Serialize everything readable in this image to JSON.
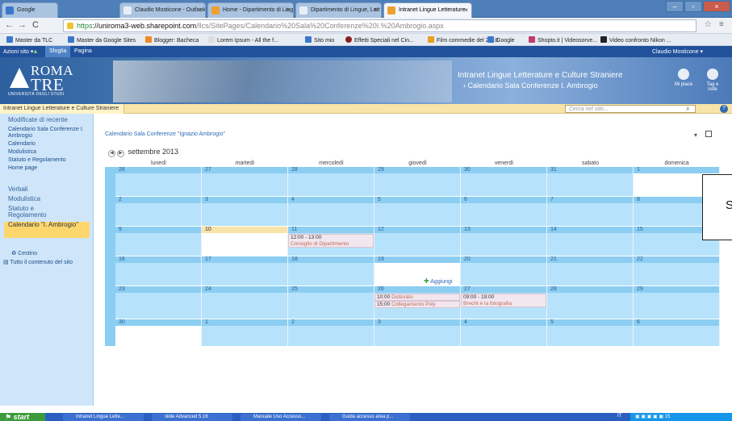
{
  "browser": {
    "tabs": [
      {
        "label": "Google"
      },
      {
        "label": "Claudio Mosticone - Outlook"
      },
      {
        "label": "Home - Dipartimento di Ling"
      },
      {
        "label": "Dipartimento di Lingue, Lett"
      },
      {
        "label": "Intranet Lingue Letterature"
      }
    ],
    "url_scheme": "https",
    "url_host": "://uniroma3-web.sharepoint.com",
    "url_path": "/llcs/SitePages/Calendario%20Sala%20Conferenze%20I.%20Ambrogio.aspx",
    "bookmarks": [
      "Master da TLC",
      "Master da Google Sites",
      "Blogger: Bacheca",
      "Lorem Ipsum - All the f...",
      "Sito mio",
      "Effetti Speciali nel Cin...",
      "Film commedie del 2010",
      "Google",
      "Shopto.it | Videosorve...",
      "Video confronto Nikon ..."
    ]
  },
  "ribbon": {
    "site_actions": "Azioni sito ▾",
    "browse_tab": "Sfoglia",
    "page_tab": "Pagina",
    "user": "Claudio Mosticone ▾"
  },
  "header": {
    "logo_line1": "ROMA",
    "logo_line2": "TRE",
    "logo_sub": "UNIVERSITÀ DEGLI STUDI",
    "site_title": "Intranet Lingue Letterature e Culture Straniere",
    "page_title": "› Calendario Sala Conferenze I. Ambrogio",
    "like_label": "Mi piace",
    "tags_label": "Tag e note"
  },
  "titlebar": {
    "breadcrumb": "Intranet Lingue Letterature e Culture Straniere",
    "search_placeholder": "Cerca nel sito..."
  },
  "leftnav": {
    "recent_header": "Modificate di recente",
    "recent_items": [
      "Calendario Sala Conferenze I. Ambrogio",
      "Calendario",
      "Modulistica",
      "Statuto e Regolamento",
      "Home page"
    ],
    "items": [
      "Verbali",
      "Modulistica",
      "Statuto e Regolamento",
      "Calendario \"I. Ambrogio\""
    ],
    "recycle": "Cestino",
    "all_content": "Tutto il contenuto del sito"
  },
  "calendar": {
    "title": "Calendario Sala Conferenze \"Ignazio Ambrogio\"",
    "month": "settembre 2013",
    "day_names": [
      "lunedì",
      "martedì",
      "mercoledì",
      "giovedì",
      "venerdì",
      "sabato",
      "domenica"
    ],
    "weeks": [
      [
        "26",
        "27",
        "28",
        "29",
        "30",
        "31",
        "1"
      ],
      [
        "2",
        "3",
        "4",
        "5",
        "6",
        "7",
        "8"
      ],
      [
        "9",
        "10",
        "11",
        "12",
        "13",
        "14",
        "15"
      ],
      [
        "16",
        "17",
        "18",
        "19",
        "20",
        "21",
        "22"
      ],
      [
        "23",
        "24",
        "25",
        "26",
        "27",
        "28",
        "29"
      ],
      [
        "30",
        "1",
        "2",
        "3",
        "4",
        "5",
        "6"
      ]
    ],
    "events": {
      "e1_time": "12:00 - 13:00",
      "e1_title": "Consiglio di Dipartimento",
      "e2_time": "10:00",
      "e2_title": "Dottorato",
      "e3_time": "15:00",
      "e3_title": "Collegamento Poly",
      "e4_time": "09:00 - 19:00",
      "e4_title": "Brecht e la fotografia"
    },
    "add_label": "Aggiungi"
  },
  "overlay": {
    "text": "S"
  },
  "taskbar": {
    "start": "start",
    "items": [
      "Intranet Lingue Lette...",
      "slide Advanced 5.16",
      "Manuale Uso Accesso...",
      "Guida accesso area p..."
    ],
    "lang": "IT",
    "clock": "15"
  }
}
